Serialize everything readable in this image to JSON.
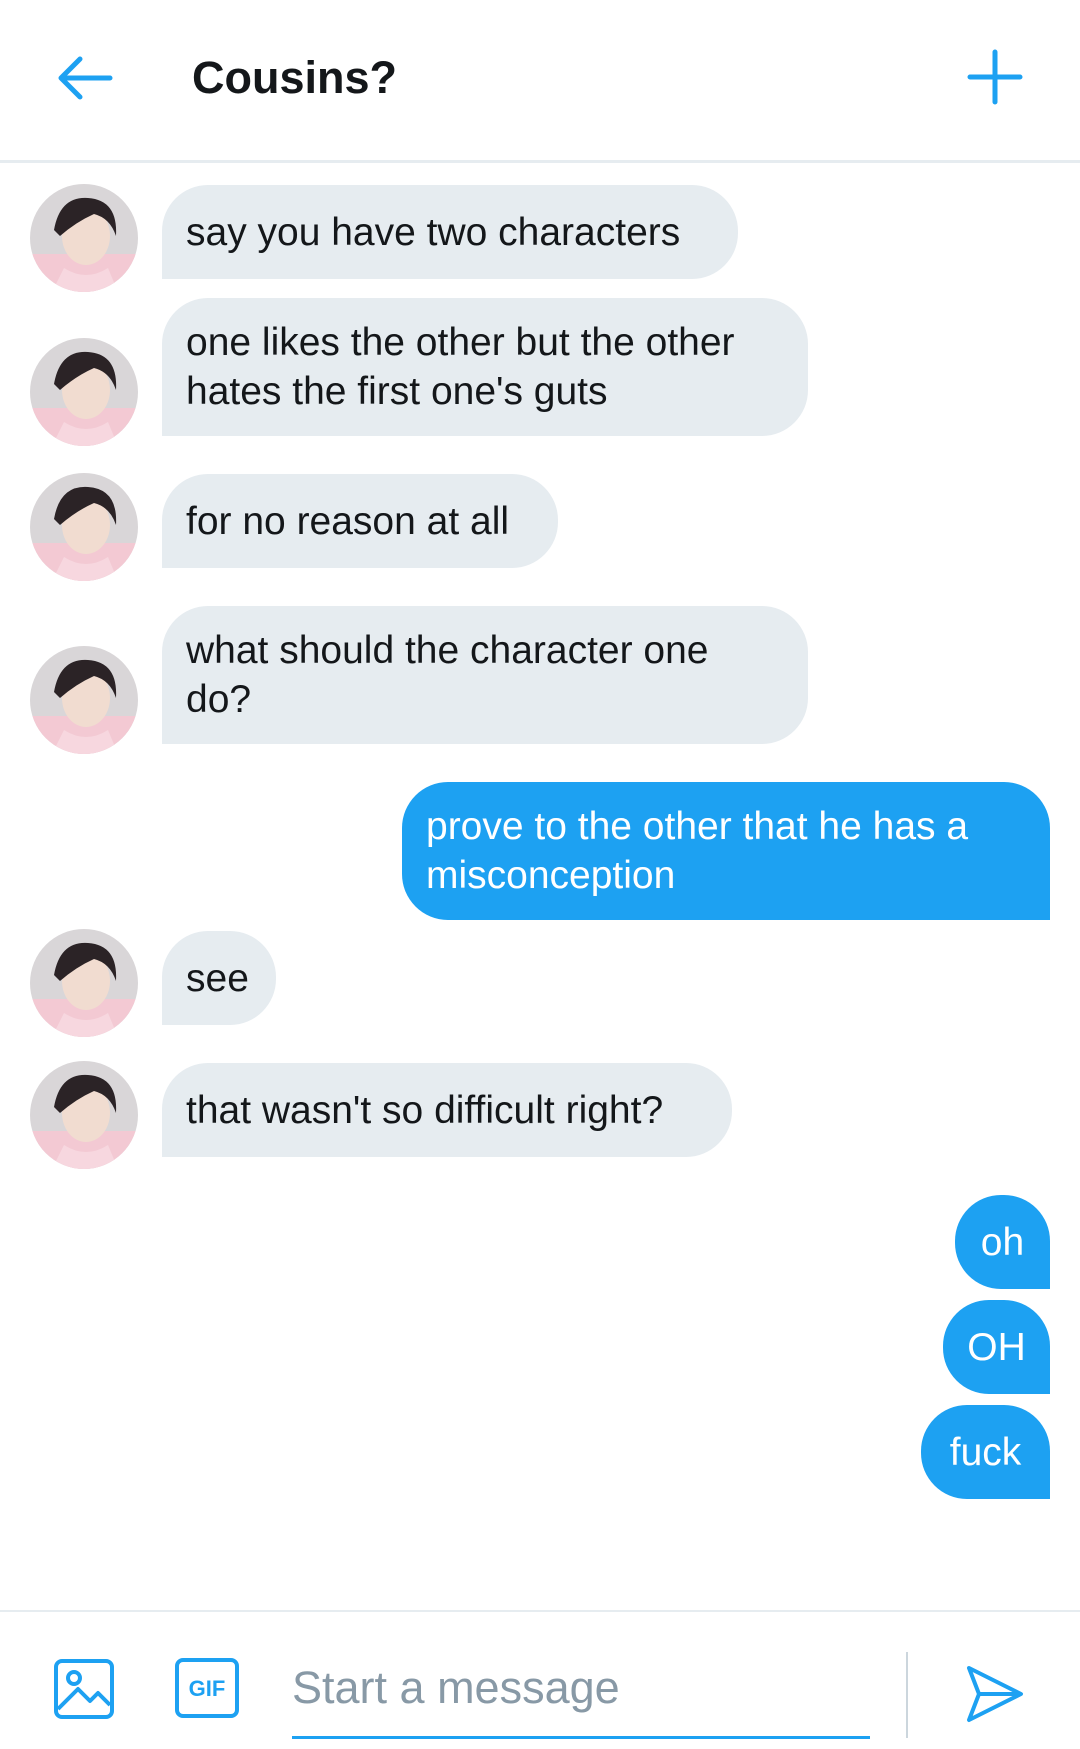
{
  "header": {
    "back_icon": "arrow-left-icon",
    "title": "Cousins?",
    "add_icon": "plus-icon"
  },
  "colors": {
    "accent": "#1da1f2",
    "incoming_bubble": "#e6ecf0",
    "divider": "#e6ecf0",
    "placeholder": "#8899a6"
  },
  "messages": [
    {
      "side": "in",
      "lines": [
        "say you have two characters"
      ]
    },
    {
      "side": "in",
      "lines": [
        "one likes the other but the other",
        "hates the first one's guts"
      ]
    },
    {
      "side": "in",
      "lines": [
        "for no reason at all"
      ]
    },
    {
      "side": "in",
      "lines": [
        "what should the character one",
        "do?"
      ]
    },
    {
      "side": "out",
      "lines": [
        "prove to the other that he has a",
        "misconception"
      ]
    },
    {
      "side": "in",
      "lines": [
        "see"
      ]
    },
    {
      "side": "in",
      "lines": [
        "that wasn't so difficult right?"
      ]
    },
    {
      "side": "out",
      "lines": [
        "oh"
      ]
    },
    {
      "side": "out",
      "lines": [
        "OH"
      ]
    },
    {
      "side": "out",
      "lines": [
        "fuck"
      ]
    }
  ],
  "compose": {
    "image_icon": "image-icon",
    "gif_label": "GIF",
    "placeholder": "Start a message",
    "send_icon": "send-icon"
  }
}
